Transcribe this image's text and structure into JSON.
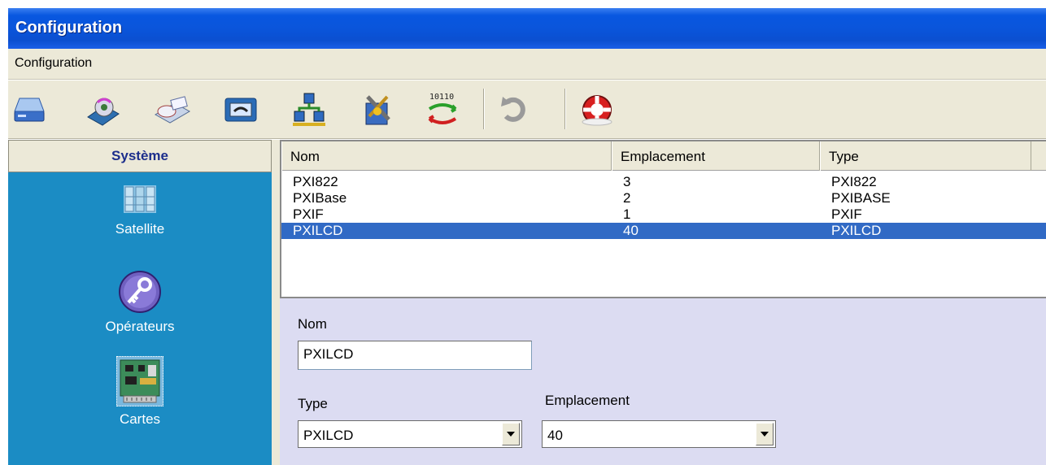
{
  "window": {
    "title": "Configuration"
  },
  "menubar": {
    "items": [
      "Configuration"
    ]
  },
  "toolbar": {
    "buttons": [
      "drive-icon",
      "disk-icon",
      "mail-tray-icon",
      "phone-icon",
      "network-icon",
      "tools-icon",
      "binary-sync-icon",
      "undo-icon",
      "lifebuoy-icon"
    ]
  },
  "sidebar": {
    "header": "Système",
    "items": [
      {
        "label": "Satellite",
        "icon": "satellite-icon"
      },
      {
        "label": "Opérateurs",
        "icon": "key-icon"
      },
      {
        "label": "Cartes",
        "icon": "circuit-board-icon"
      }
    ]
  },
  "list": {
    "columns": [
      "Nom",
      "Emplacement",
      "Type"
    ],
    "rows": [
      {
        "nom": "PXI822",
        "emplacement": "3",
        "type": "PXI822"
      },
      {
        "nom": "PXIBase",
        "emplacement": "2",
        "type": "PXIBASE"
      },
      {
        "nom": "PXIF",
        "emplacement": "1",
        "type": "PXIF"
      },
      {
        "nom": "PXILCD",
        "emplacement": "40",
        "type": "PXILCD"
      }
    ],
    "selected_row": 3
  },
  "detail": {
    "nom_label": "Nom",
    "nom_value": "PXILCD",
    "type_label": "Type",
    "type_value": "PXILCD",
    "emplacement_label": "Emplacement",
    "emplacement_value": "40"
  },
  "colors": {
    "titlebar": "#0a55db",
    "sidebar": "#1b8cc4",
    "selection": "#316ac5",
    "detail_bg": "#dcdcf2"
  }
}
